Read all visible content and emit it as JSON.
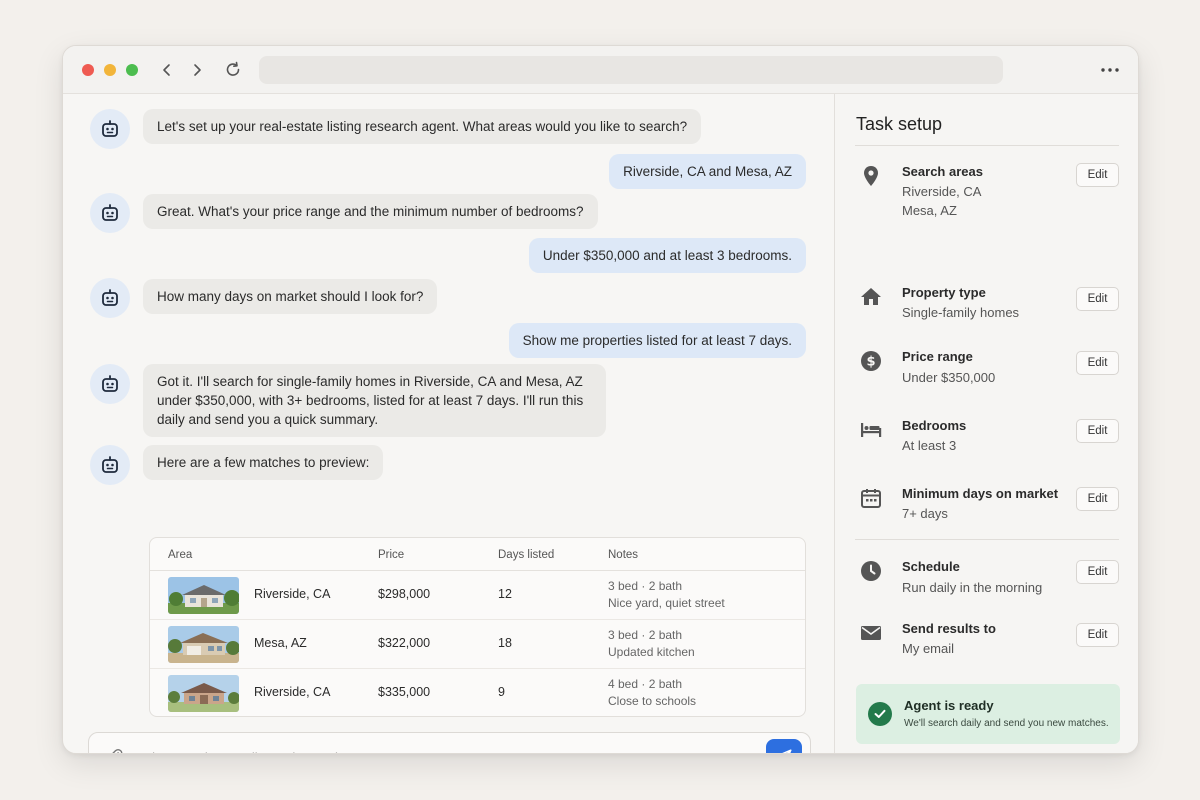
{
  "chat": {
    "messages": [
      {
        "role": "bot",
        "text": "Let's set up your real-estate listing research agent. What areas would you like to search?"
      },
      {
        "role": "user",
        "text": "Riverside, CA and Mesa, AZ"
      },
      {
        "role": "bot",
        "text": "Great. What's your price range and the minimum number of bedrooms?"
      },
      {
        "role": "user",
        "text": "Under $350,000 and at least 3 bedrooms."
      },
      {
        "role": "bot",
        "text": "How many days on market should I look for?"
      },
      {
        "role": "user",
        "text": "Show me properties listed for at least 7 days."
      },
      {
        "role": "bot",
        "text": "Got it. I'll search for single-family homes in Riverside, CA and Mesa, AZ under $350,000, with 3+ bedrooms, listed for at least 7 days. I'll run this daily and send you a quick summary."
      },
      {
        "role": "bot",
        "text": "Here are a few matches to preview:"
      }
    ],
    "table": {
      "headers": [
        "Area",
        "Price",
        "Days listed",
        "Notes"
      ],
      "rows": [
        {
          "area": "Riverside, CA",
          "price": "$298,000",
          "days": "12",
          "note1": "3 bed · 2 bath",
          "note2": "Nice yard, quiet street"
        },
        {
          "area": "Mesa, AZ",
          "price": "$322,000",
          "days": "18",
          "note1": "3 bed · 2 bath",
          "note2": "Updated kitchen"
        },
        {
          "area": "Riverside, CA",
          "price": "$335,000",
          "days": "9",
          "note1": "4 bed · 2 bath",
          "note2": "Close to schools"
        }
      ]
    },
    "composer": {
      "placeholder": "Ask a question or tell me what to change...",
      "value": ""
    }
  },
  "panel": {
    "title": "Task setup",
    "edit_label": "Edit",
    "settings": [
      {
        "icon": "location-pin-icon",
        "title": "Search areas",
        "values": [
          "Riverside, CA",
          "Mesa, AZ"
        ]
      },
      {
        "icon": "home-icon",
        "title": "Property type",
        "values": [
          "Single-family homes"
        ]
      },
      {
        "icon": "dollar-icon",
        "title": "Price range",
        "values": [
          "Under $350,000"
        ]
      },
      {
        "icon": "bed-icon",
        "title": "Bedrooms",
        "values": [
          "At least 3"
        ]
      },
      {
        "icon": "calendar-icon",
        "title": "Minimum days on market",
        "values": [
          "7+ days"
        ]
      },
      {
        "icon": "clock-icon",
        "title": "Schedule",
        "values": [
          "Run daily in the morning"
        ]
      },
      {
        "icon": "mail-icon",
        "title": "Send results to",
        "values": [
          "My email"
        ]
      }
    ],
    "ready": {
      "title": "Agent is ready",
      "subtitle": "We'll search daily and send you new matches."
    }
  },
  "colors": {
    "accent": "#2d6fe0",
    "ready_bg": "#dcefe2",
    "ready_check": "#237a4b",
    "user_bubble": "#dde8f7",
    "bot_bubble": "#ebeae7"
  }
}
